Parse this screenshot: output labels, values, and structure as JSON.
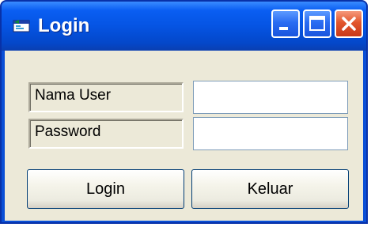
{
  "window": {
    "title": "Login",
    "icon": "form-icon",
    "controls": {
      "minimize_icon": "minimize-icon",
      "maximize_icon": "maximize-icon",
      "close_icon": "close-icon"
    }
  },
  "form": {
    "username_label": "Nama User",
    "username_value": "",
    "password_label": "Password",
    "password_value": "",
    "login_button": "Login",
    "exit_button": "Keluar"
  },
  "colors": {
    "titlebar": "#0554e3",
    "client_background": "#ece9d8",
    "close_button": "#e2562c"
  }
}
